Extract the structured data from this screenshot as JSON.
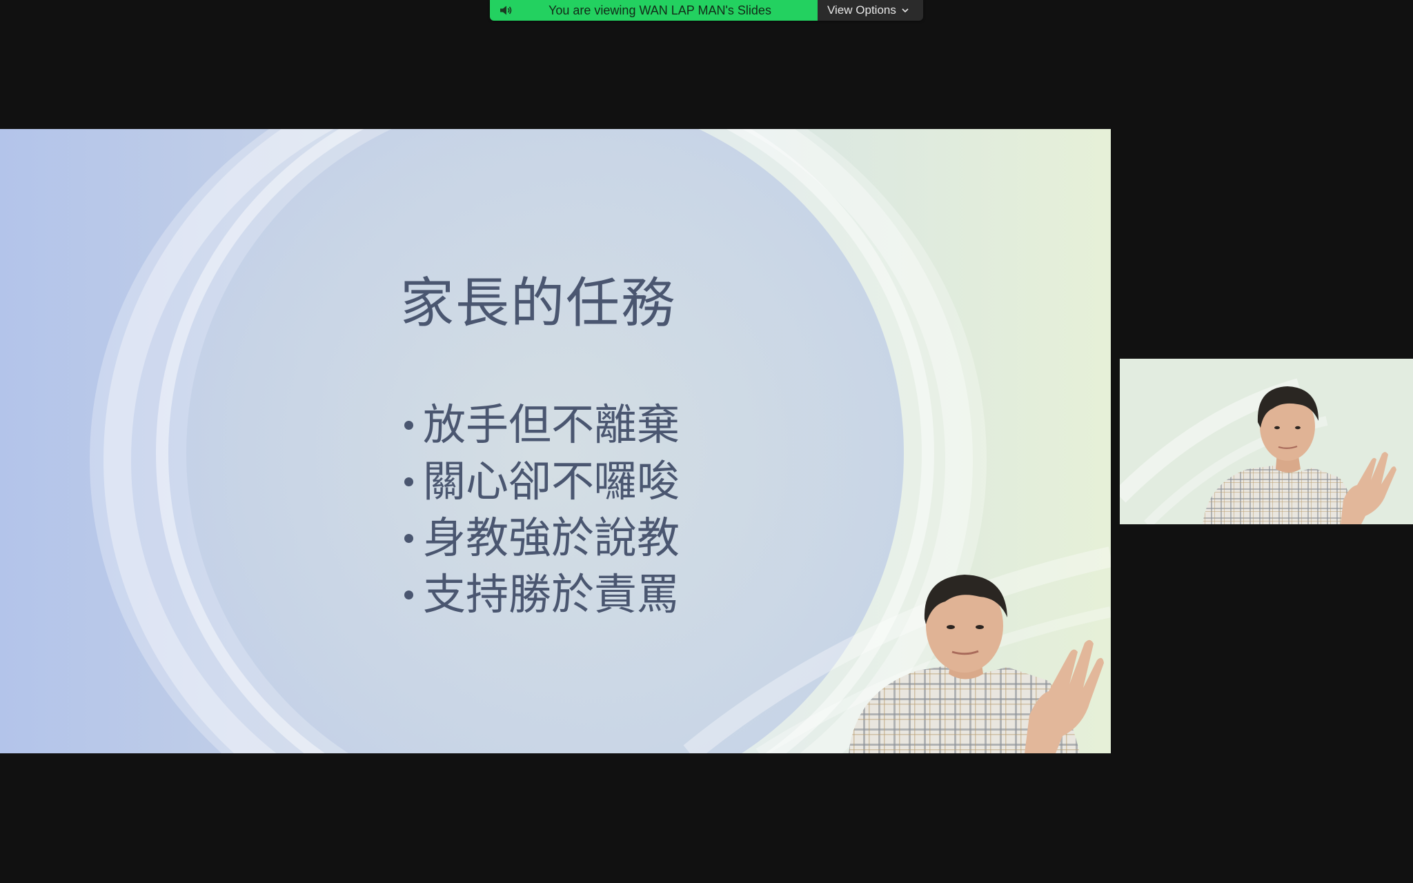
{
  "share_banner": {
    "status_text": "You are viewing WAN LAP MAN's Slides",
    "view_options_label": "View Options",
    "status_color": "#23d160",
    "icons": {
      "speaker": "speaker-icon",
      "dropdown": "chevron-down-icon"
    }
  },
  "slide": {
    "title": "家長的任務",
    "bullets": [
      "放手但不離棄",
      "關心卻不囉唆",
      "身教強於說教",
      "支持勝於責罵"
    ],
    "text_color": "#4a5670"
  },
  "video": {
    "presenter_tile": "presenter-video",
    "self_view_tile": "self-view-video"
  }
}
